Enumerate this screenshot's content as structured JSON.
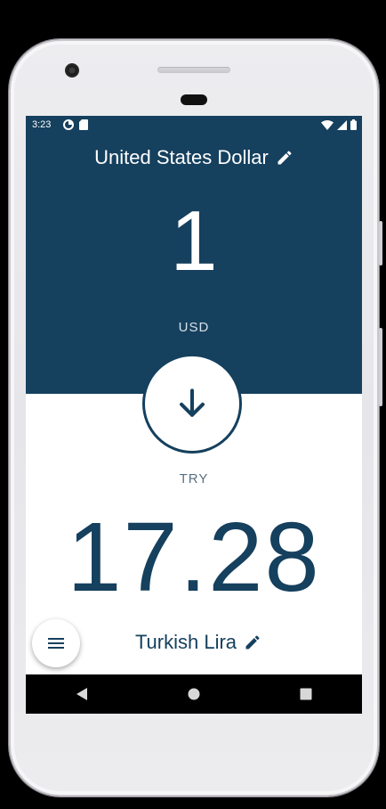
{
  "status_bar": {
    "time": "3:23",
    "left_icons": [
      "data-saver-icon",
      "sd-card-icon"
    ],
    "right_icons": [
      "wifi-icon",
      "signal-icon",
      "battery-icon"
    ]
  },
  "from_currency": {
    "name": "United States Dollar",
    "amount": "1",
    "code": "USD"
  },
  "to_currency": {
    "name": "Turkish Lira",
    "amount": "17.28",
    "code": "TRY"
  },
  "colors": {
    "primary": "#15405e",
    "background": "#ffffff"
  },
  "icons": {
    "edit": "pencil-icon",
    "swap": "arrow-down-icon",
    "menu": "hamburger-menu-icon",
    "nav_back": "back-triangle-icon",
    "nav_home": "home-circle-icon",
    "nav_recents": "recents-square-icon"
  }
}
